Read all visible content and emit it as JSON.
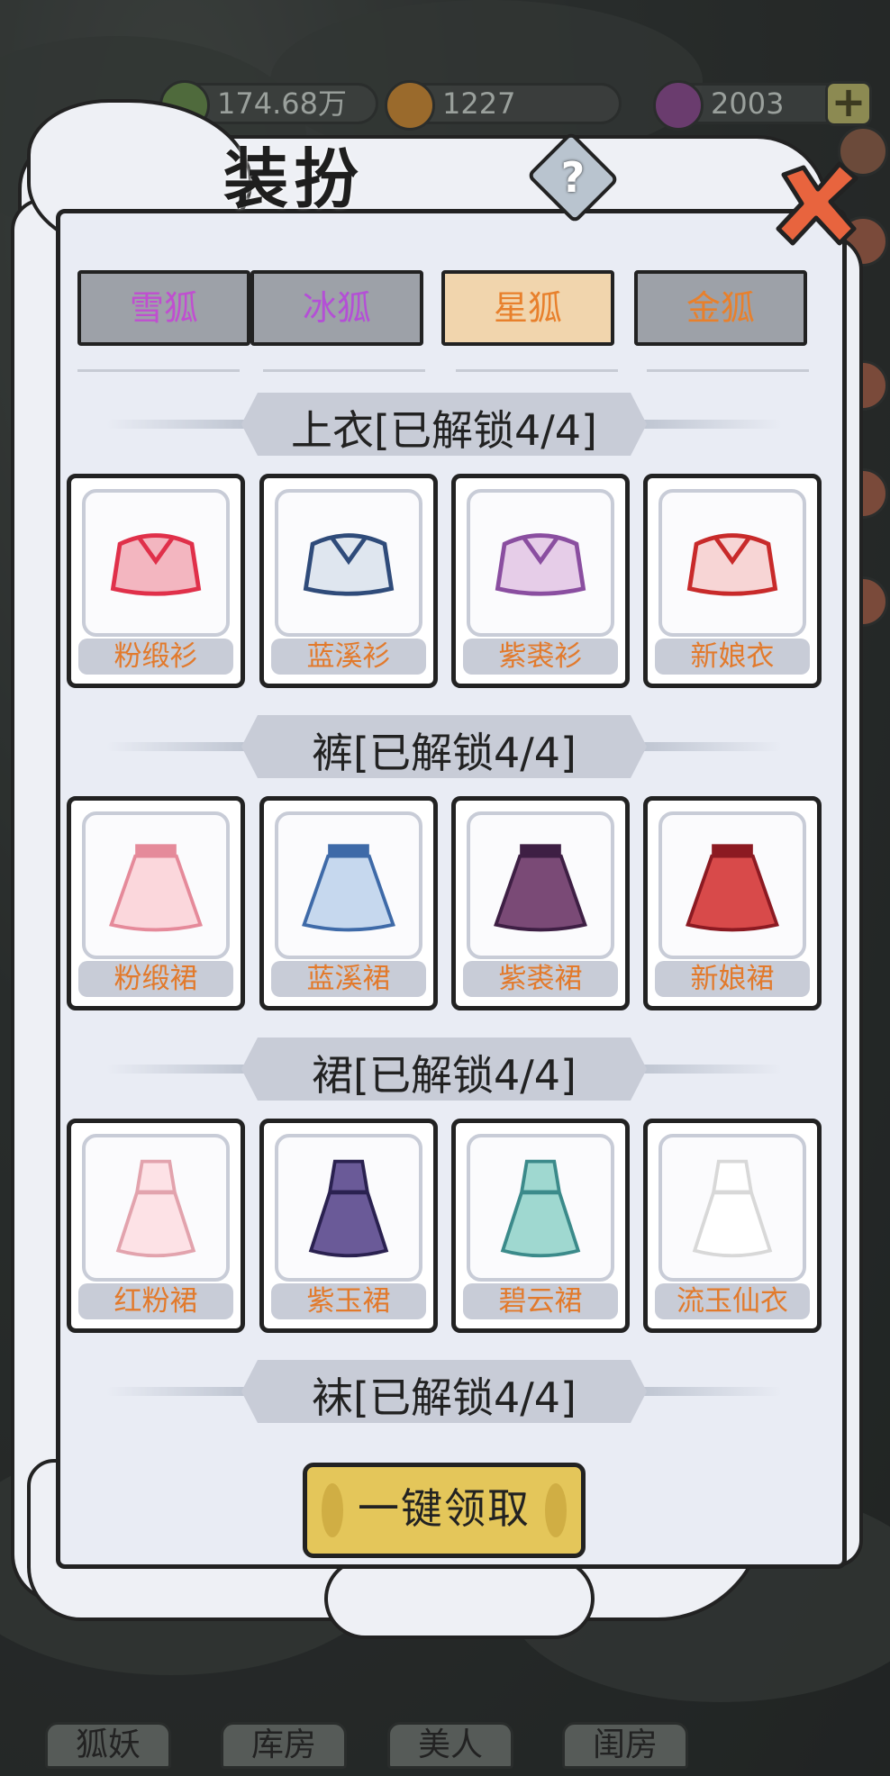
{
  "resources": [
    {
      "name": "green-currency",
      "value": "174.68万",
      "color": "#5d8a45"
    },
    {
      "name": "orange-currency",
      "value": "1227",
      "color": "#d6883a"
    },
    {
      "name": "purple-currency",
      "value": "2003",
      "color": "#8a4e8e"
    }
  ],
  "bottom_nav": [
    "狐妖",
    "库房",
    "美人",
    "闺房"
  ],
  "dialog": {
    "title": "装扮",
    "help_icon": "?",
    "claim_label": "一键领取"
  },
  "tabs": [
    {
      "label": "雪狐",
      "color": "#c04fd0",
      "active": false
    },
    {
      "label": "冰狐",
      "color": "#b44fd6",
      "active": false
    },
    {
      "label": "星狐",
      "color": "#e8802c",
      "active": true
    },
    {
      "label": "金狐",
      "color": "#e8802c",
      "active": false
    }
  ],
  "sections": [
    {
      "title": "上衣[已解锁4/4]",
      "items": [
        "粉缎衫",
        "蓝溪衫",
        "紫裘衫",
        "新娘衣"
      ]
    },
    {
      "title": "裤[已解锁4/4]",
      "items": [
        "粉缎裙",
        "蓝溪裙",
        "紫裘裙",
        "新娘裙"
      ]
    },
    {
      "title": "裙[已解锁4/4]",
      "items": [
        "红粉裙",
        "紫玉裙",
        "碧云裙",
        "流玉仙衣"
      ]
    },
    {
      "title": "袜[已解锁4/4]",
      "items": []
    }
  ]
}
